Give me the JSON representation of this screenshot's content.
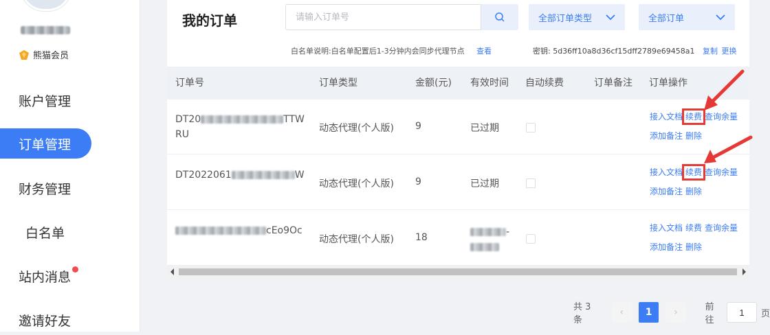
{
  "sidebar": {
    "member_label": "熊猫会员",
    "items": [
      {
        "label": "账户管理"
      },
      {
        "label": "订单管理"
      },
      {
        "label": "财务管理"
      },
      {
        "label": "白名单"
      },
      {
        "label": "站内消息"
      },
      {
        "label": "邀请好友"
      }
    ]
  },
  "main": {
    "title": "我的订单",
    "search_placeholder": "请输入订单号",
    "filter_type": "全部订单类型",
    "filter_status": "全部订单",
    "whitelist_note": "白名单说明:白名单配置后1-3分钟内会同步代理节点",
    "view_link": "查看",
    "secret_label": "密钥: 5d36ff10a8d36cf15dff2789e69458a1",
    "copy_link": "复制",
    "change_link": "更换"
  },
  "table": {
    "headers": [
      "订单号",
      "订单类型",
      "金额(元)",
      "有效时间",
      "自动续费",
      "订单备注",
      "订单操作"
    ],
    "rows": [
      {
        "order_prefix": "DT20",
        "order_suffix": "TTWRU",
        "type": "动态代理(个人版)",
        "amount": "9",
        "validity": "已过期"
      },
      {
        "order_prefix": "DT2022061",
        "order_suffix": "W",
        "type": "动态代理(个人版)",
        "amount": "9",
        "validity": "已过期"
      },
      {
        "order_prefix": "",
        "order_suffix": "cEo9Oc",
        "type": "动态代理(个人版)",
        "amount": "18",
        "validity": "-"
      }
    ],
    "ops": {
      "doc": "接入文档",
      "renew": "续费",
      "balance": "查询余量",
      "note": "添加备注",
      "delete": "删除"
    }
  },
  "pagination": {
    "total": "共 3 条",
    "current": "1",
    "goto_label": "前往",
    "goto_value": "1",
    "page_suffix": "页",
    "prev": "‹",
    "next": "›"
  },
  "colors": {
    "accent": "#3c7cf5",
    "annotation": "#e53935"
  }
}
